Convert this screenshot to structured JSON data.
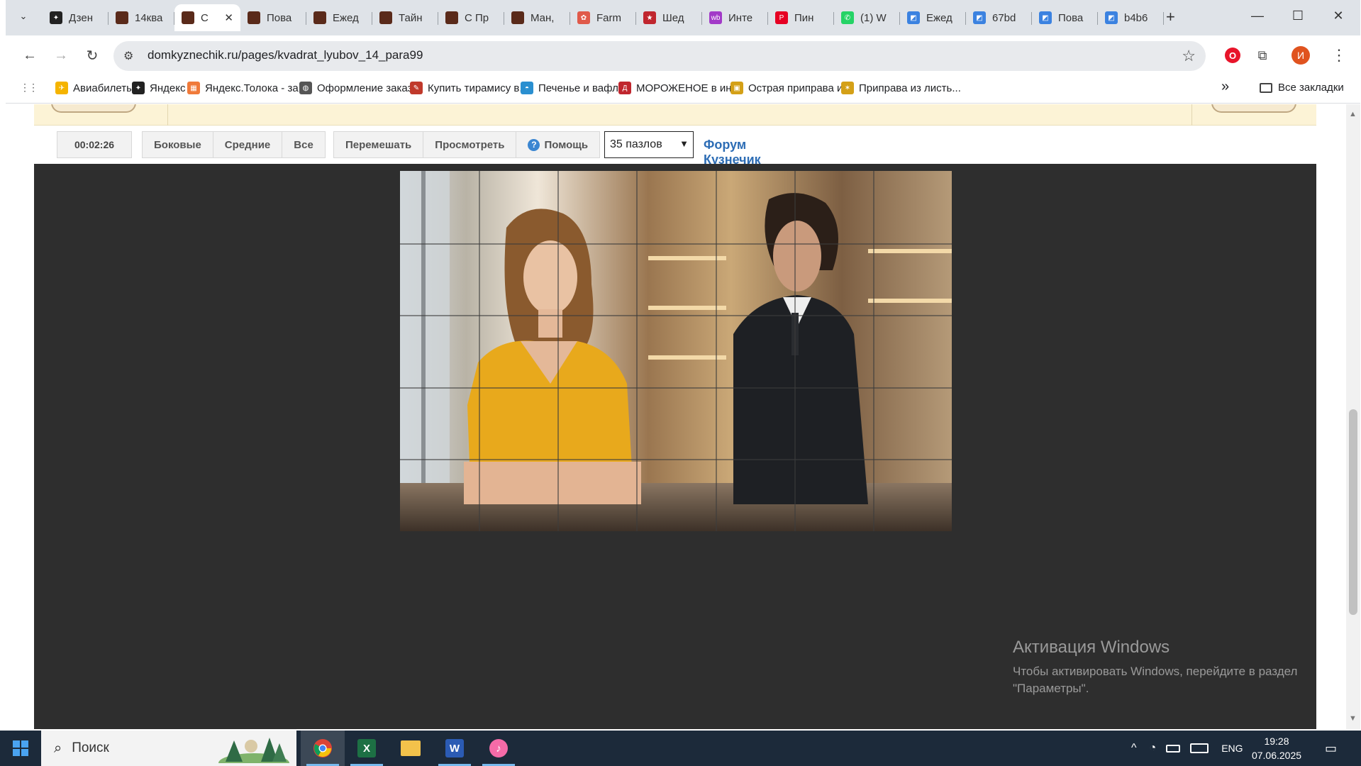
{
  "tabs": [
    {
      "title": "Дзен",
      "fav_color": "#222222",
      "fav_glyph": "✦"
    },
    {
      "title": "14ква",
      "fav_color": "#5a2a1a",
      "fav_glyph": ""
    },
    {
      "title": "С",
      "fav_color": "#5a2a1a",
      "fav_glyph": "",
      "active": true
    },
    {
      "title": "Пова",
      "fav_color": "#5a2a1a",
      "fav_glyph": ""
    },
    {
      "title": "Ежед",
      "fav_color": "#5a2a1a",
      "fav_glyph": ""
    },
    {
      "title": "Тайн",
      "fav_color": "#5a2a1a",
      "fav_glyph": ""
    },
    {
      "title": "С Пр",
      "fav_color": "#5a2a1a",
      "fav_glyph": ""
    },
    {
      "title": "Ман,",
      "fav_color": "#5a2a1a",
      "fav_glyph": ""
    },
    {
      "title": "Farm",
      "fav_color": "#e05a4a",
      "fav_glyph": "✿"
    },
    {
      "title": "Шед",
      "fav_color": "#c0262e",
      "fav_glyph": "★"
    },
    {
      "title": "Инте",
      "fav_color": "#a23ac8",
      "fav_glyph": "wb"
    },
    {
      "title": "Пин",
      "fav_color": "#e60023",
      "fav_glyph": "P"
    },
    {
      "title": "(1) W",
      "fav_color": "#25d366",
      "fav_glyph": "✆"
    },
    {
      "title": "Ежед",
      "fav_color": "#3b82e0",
      "fav_glyph": "◩"
    },
    {
      "title": "67bd",
      "fav_color": "#3b82e0",
      "fav_glyph": "◩"
    },
    {
      "title": "Пова",
      "fav_color": "#3b82e0",
      "fav_glyph": "◩"
    },
    {
      "title": "b4b6",
      "fav_color": "#3b82e0",
      "fav_glyph": "◩"
    }
  ],
  "tab_close": "✕",
  "new_tab": "+",
  "window_controls": {
    "minimize": "—",
    "maximize": "☐",
    "close": "✕"
  },
  "nav": {
    "back": "←",
    "forward": "→",
    "reload": "↻"
  },
  "address": {
    "url": "domkyznechik.ru/pages/kvadrat_lyubov_14_para99",
    "site_info": "⚙",
    "star": "☆"
  },
  "toolbar_icons": {
    "opera": "O",
    "extensions": "⧉",
    "profile": "И",
    "menu": "⋮"
  },
  "bookmarks": [
    {
      "label": "Авиабилеты",
      "color": "#f5b400",
      "glyph": "✈"
    },
    {
      "label": "Яндекс",
      "color": "#222222",
      "glyph": "✦"
    },
    {
      "label": "Яндекс.Толока - за...",
      "color": "#f07a3a",
      "glyph": "▦"
    },
    {
      "label": "Оформление заказ...",
      "color": "#555555",
      "glyph": "◍"
    },
    {
      "label": "Купить тирамису в...",
      "color": "#c0392b",
      "glyph": "✎"
    },
    {
      "label": "Печенье и вафли",
      "color": "#2a8fd0",
      "glyph": "◓"
    },
    {
      "label": "МОРОЖЕНОЕ в ин...",
      "color": "#c0262e",
      "glyph": "Д"
    },
    {
      "label": "Острая приправа и...",
      "color": "#d4a017",
      "glyph": "▣"
    },
    {
      "label": "Приправа из листь...",
      "color": "#d4a017",
      "glyph": "✶"
    }
  ],
  "bookmarks_more": "»",
  "all_bookmarks": "Все закладки",
  "apps_icon": "⋮⋮",
  "controls": {
    "timer": "00:02:26",
    "filters": [
      "Боковые",
      "Средние",
      "Все"
    ],
    "actions": [
      "Перемешать",
      "Просмотреть"
    ],
    "help": "Помощь",
    "help_glyph": "?",
    "select_value": "35 пазлов",
    "select_arrow": "▼",
    "forum": "Форум Кузнечик"
  },
  "puzzle": {
    "cols": 7,
    "rows": 5
  },
  "activation": {
    "title": "Активация Windows",
    "line1": "Чтобы активировать Windows, перейдите в раздел",
    "line2": "\"Параметры\"."
  },
  "taskbar": {
    "search_placeholder": "Поиск",
    "lang": "ENG",
    "time": "19:28",
    "date": "07.06.2025",
    "tray_up": "^",
    "notify": "▭"
  }
}
